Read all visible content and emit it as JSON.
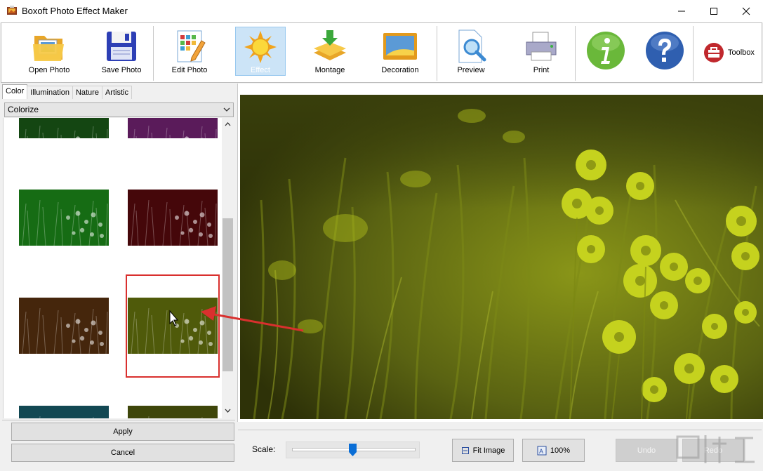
{
  "window": {
    "title": "Boxoft Photo Effect Maker"
  },
  "toolbar": {
    "open_photo": "Open Photo",
    "save_photo": "Save Photo",
    "edit_photo": "Edit Photo",
    "effect": "Effect",
    "montage": "Montage",
    "decoration": "Decoration",
    "preview": "Preview",
    "print": "Print",
    "toolbox": "Toolbox"
  },
  "left_panel": {
    "tabs": [
      "Color",
      "Illumination",
      "Nature",
      "Artistic"
    ],
    "active_tab": "Color",
    "effect_select": "Colorize",
    "thumbnail_colors": [
      "#1f6b1c",
      "#8a2a8a",
      "#22a61f",
      "#6a0b10",
      "#6a3a12",
      "#7a8a10",
      "#1c6f80",
      "#5f6b10"
    ],
    "selected_thumbnail": "yellow-green",
    "apply_label": "Apply",
    "cancel_label": "Cancel"
  },
  "bottom_bar": {
    "scale_label": "Scale:",
    "scale_value_fraction": 0.5,
    "fit_image_label": "Fit Image",
    "zoom_100_label": "100%",
    "undo_label": "Undo",
    "redo_label": "Redo"
  },
  "colors": {
    "annotation_red": "#d9302e",
    "preview_tint": "#a8b418",
    "toolbar_active": "#cce4f7"
  }
}
